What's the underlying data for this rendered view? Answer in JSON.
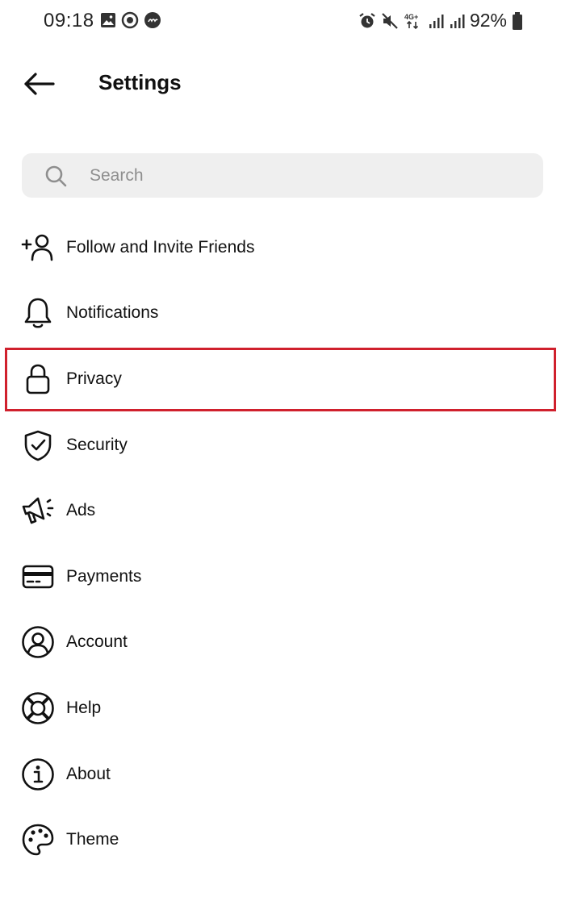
{
  "status_bar": {
    "time": "09:18",
    "battery": "92%",
    "network": "4G+",
    "left_icons": [
      "image-icon",
      "sync-icon",
      "notification-badge-icon"
    ],
    "right_icons": [
      "alarm-icon",
      "mute-icon",
      "4g-icon",
      "signal-icon",
      "signal-icon",
      "battery-icon"
    ]
  },
  "header": {
    "title": "Settings",
    "back_icon": "arrow-left-icon"
  },
  "search": {
    "placeholder": "Search",
    "value": "",
    "icon": "search-icon"
  },
  "menu": {
    "items": [
      {
        "label": "Follow and Invite Friends",
        "icon": "add-person-icon"
      },
      {
        "label": "Notifications",
        "icon": "bell-icon"
      },
      {
        "label": "Privacy",
        "icon": "lock-icon",
        "highlighted": true
      },
      {
        "label": "Security",
        "icon": "shield-check-icon"
      },
      {
        "label": "Ads",
        "icon": "megaphone-icon"
      },
      {
        "label": "Payments",
        "icon": "credit-card-icon"
      },
      {
        "label": "Account",
        "icon": "user-circle-icon"
      },
      {
        "label": "Help",
        "icon": "lifebuoy-icon"
      },
      {
        "label": "About",
        "icon": "info-icon"
      },
      {
        "label": "Theme",
        "icon": "palette-icon"
      }
    ]
  },
  "colors": {
    "highlight": "#d0202d",
    "search_background": "#efefef",
    "placeholder": "#8e8e8e",
    "text": "#111111"
  }
}
